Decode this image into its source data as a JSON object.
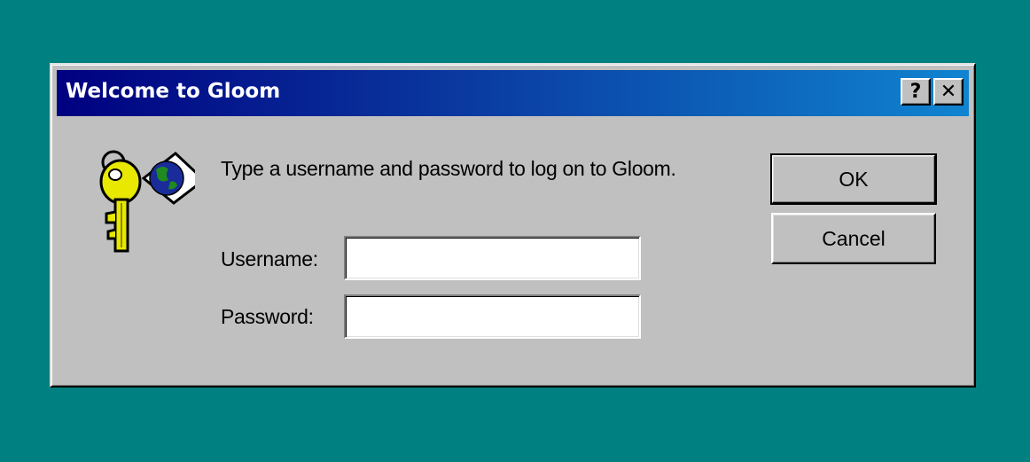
{
  "dialog": {
    "title": "Welcome to Gloom",
    "help_button": "?",
    "close_button": "✕",
    "prompt": "Type a username and password to log on to Gloom.",
    "username_label": "Username:",
    "password_label": "Password:",
    "username_value": "",
    "password_value": "",
    "ok_label": "OK",
    "cancel_label": "Cancel",
    "icon": "key-globe-icon"
  },
  "colors": {
    "desktop": "#008080",
    "titlebar_start": "#000080",
    "titlebar_end": "#1084d0",
    "face": "#c0c0c0"
  }
}
